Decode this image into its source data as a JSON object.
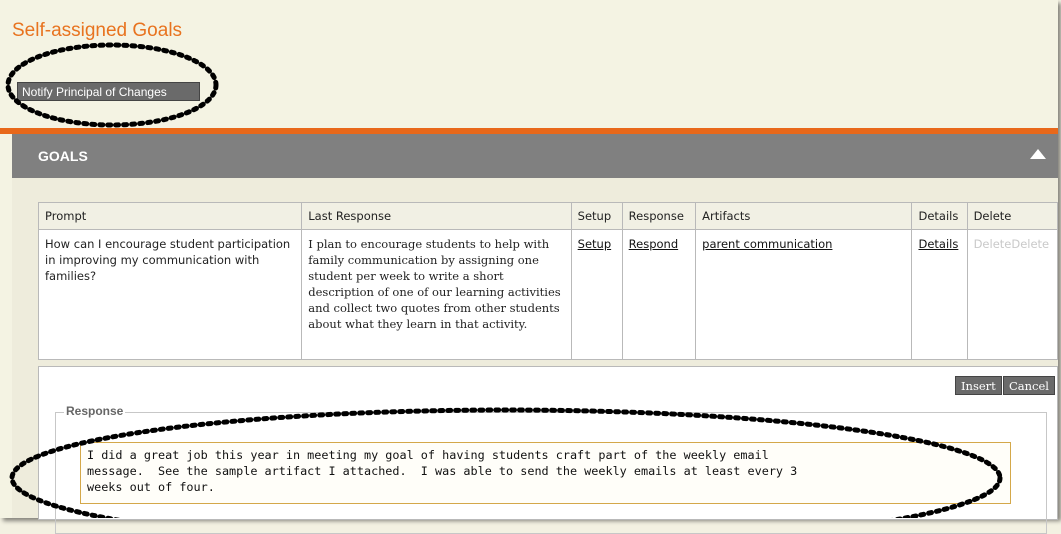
{
  "page": {
    "title": "Self-assigned Goals",
    "notify_button": "Notify Principal of Changes"
  },
  "goals": {
    "header": "GOALS",
    "table": {
      "columns": [
        "Prompt",
        "Last Response",
        "Setup",
        "Response",
        "Artifacts",
        "Details",
        "Delete"
      ],
      "rows": [
        {
          "prompt": "How can I encourage student participation in improving my communication with families?",
          "last_response": "I plan to encourage students to help with family communication by assigning one student per week to write a short description of one of our learning activities and collect two quotes from other students about what they learn in that activity.",
          "setup": "Setup",
          "response": "Respond",
          "artifacts": "parent communication",
          "details": "Details",
          "delete": "DeleteDelete"
        }
      ]
    }
  },
  "editor": {
    "insert_button": "Insert",
    "cancel_button": "Cancel",
    "legend": "Response",
    "text": "I did a great job this year in meeting my goal of having students craft part of the weekly email\nmessage.  See the sample artifact I attached.  I was able to send the weekly emails at least every 3\nweeks out of four."
  },
  "colors": {
    "accent_orange": "#e8681a",
    "header_gray": "#808080",
    "button_gray": "#6a6a6a"
  },
  "icons": {
    "collapse": "triangle-up-icon"
  }
}
